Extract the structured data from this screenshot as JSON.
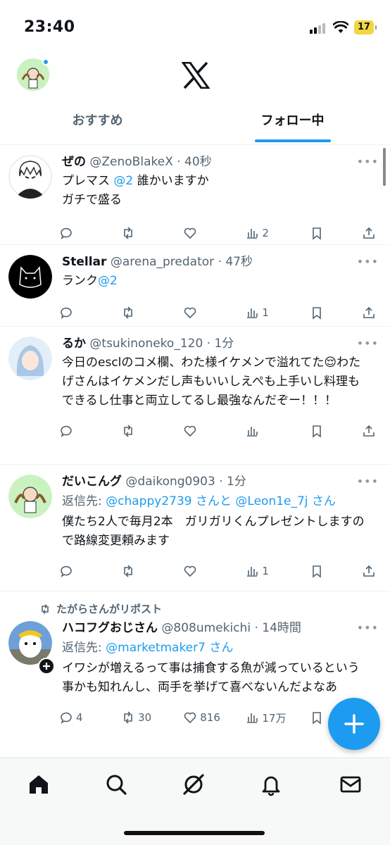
{
  "status": {
    "time": "23:40",
    "battery": "17"
  },
  "header": {
    "tabs": [
      {
        "label": "おすすめ",
        "active": false
      },
      {
        "label": "フォロー中",
        "active": true
      }
    ]
  },
  "tweets": [
    {
      "name": "ぜの",
      "handle": "@ZenoBlakeX",
      "time": "· 40秒",
      "body_pre": "プレマス ",
      "body_mention": "@2",
      "body_post": " 誰かいますか",
      "body_line2": "ガチで盛る",
      "views": "2"
    },
    {
      "name": "Stellar",
      "handle": "@arena_predator",
      "time": "· 47秒",
      "body_pre": "ランク",
      "body_mention": "@2",
      "views": "1"
    },
    {
      "name": "るか",
      "handle": "@tsukinoneko_120",
      "time": "· 1分",
      "body": "今日のesclのコメ欄、わた様イケメンで溢れてた😌わたげさんはイケメンだし声もいいしえぺも上手いし料理もできるし仕事と両立してるし最強なんだぞー！！！",
      "views": ""
    },
    {
      "name": "だいこんグ",
      "handle": "@daikong0903",
      "time": "· 1分",
      "reply_label": "返信先: ",
      "reply_mention1": "@chappy2739",
      "reply_mid": " さんと ",
      "reply_mention2": "@Leon1e_7j",
      "reply_end": " さん",
      "body": "僕たち2人で毎月2本　ガリガリくんプレゼントしますので路線変更頼みます",
      "views": "1"
    },
    {
      "repost": "たがらさんがリポスト",
      "name": "ハコフグおじさん",
      "handle": "@808umekichi",
      "time": "· 14時間",
      "reply_label": "返信先: ",
      "reply_mention1": "@marketmaker7",
      "reply_end": " さん",
      "body": "イワシが増えるって事は捕食する魚が減っているという事かも知れんし、両手を挙げて喜べないんだよなあ",
      "replies": "4",
      "reposts": "30",
      "likes": "816",
      "views": "17万"
    }
  ],
  "colors": {
    "accent": "#1d9bf0",
    "secondary": "#536471"
  },
  "icons": [
    "reply-icon",
    "repost-icon",
    "like-icon",
    "views-icon",
    "bookmark-icon",
    "share-icon"
  ],
  "nav": [
    "home-icon",
    "search-icon",
    "grok-icon",
    "notifications-icon",
    "messages-icon"
  ]
}
